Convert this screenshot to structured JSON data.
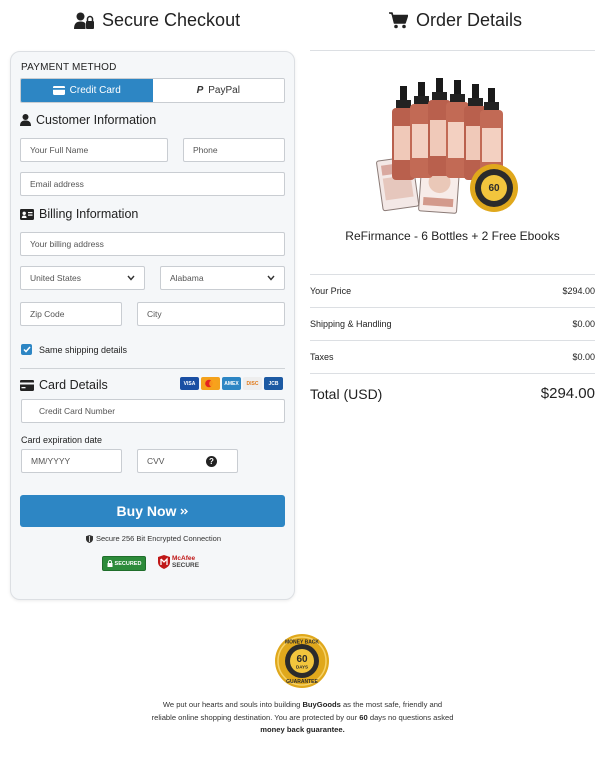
{
  "left_heading": "Secure Checkout",
  "right_heading": "Order Details",
  "payment": {
    "label": "PAYMENT METHOD",
    "tab_credit": "Credit Card",
    "tab_paypal": "PayPal"
  },
  "customer": {
    "title": "Customer Information",
    "name_placeholder": "Your Full Name",
    "phone_placeholder": "Phone",
    "email_placeholder": "Email address"
  },
  "billing": {
    "title": "Billing Information",
    "address_placeholder": "Your billing address",
    "country": "United States",
    "state": "Alabama",
    "zip_placeholder": "Zip Code",
    "city_placeholder": "City",
    "same_shipping": "Same shipping details"
  },
  "card": {
    "title": "Card Details",
    "number_placeholder": "Credit Card Number",
    "exp_label": "Card expiration date",
    "exp_placeholder": "MM/YYYY",
    "cvv_placeholder": "CVV",
    "brands": [
      "VISA",
      "MC",
      "AMEX",
      "DISC",
      "JCB"
    ]
  },
  "buy_button": "Buy Now",
  "secure_text": "Secure 256 Bit Encrypted Connection",
  "badges": {
    "ssl": "SECURED",
    "mcafee_1": "McAfee",
    "mcafee_2": "SECURE"
  },
  "order": {
    "product": "ReFirmance - 6 Bottles + 2 Free Ebooks",
    "rows": [
      {
        "label": "Your Price",
        "value": "$294.00"
      },
      {
        "label": "Shipping & Handling",
        "value": "$0.00"
      },
      {
        "label": "Taxes",
        "value": "$0.00"
      }
    ],
    "total_label": "Total (USD)",
    "total_value": "$294.00"
  },
  "seal": {
    "days": "60",
    "days_word": "DAYS",
    "top_text": "MONEY BACK",
    "bottom_text": "GUARANTEE"
  },
  "footer": {
    "t1": "We put our hearts and souls into building ",
    "brand": "BuyGoods",
    "t2": " as the most safe, friendly and reliable online shopping destination. You are protected by our ",
    "days": "60",
    "t3": " days no questions asked ",
    "guarantee": "money back guarantee."
  },
  "colors": {
    "accent": "#2d86c4",
    "card_bg": "#f5f7f9",
    "seal_gold": "#e0a81c"
  }
}
